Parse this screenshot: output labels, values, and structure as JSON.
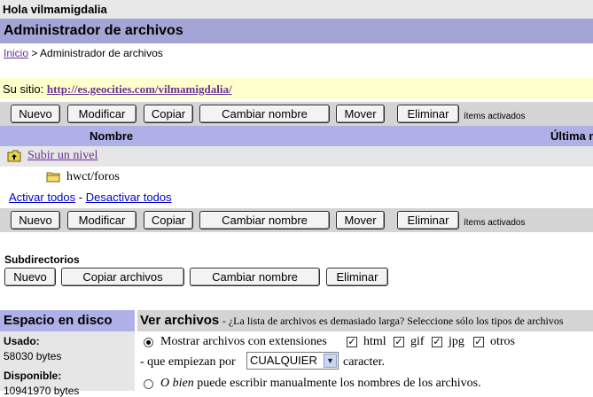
{
  "greeting": "Hola vilmamigdalia",
  "page_title": "Administrador de archivos",
  "breadcrumb": {
    "home": "Inicio",
    "separator": ">",
    "current": "Administrador de archivos"
  },
  "site": {
    "label": "Su sitio:",
    "url": "http://es.geocities.com/vilmamigdalia/"
  },
  "toolbar": {
    "new": "Nuevo",
    "modify": "Modificar",
    "copy": "Copiar",
    "rename": "Cambiar nombre",
    "move": "Mover",
    "delete": "Eliminar",
    "items_active": "ítems activados"
  },
  "table": {
    "col_name": "Nombre",
    "col_modified": "Última m",
    "up_level": "Subir un nivel",
    "rows": [
      {
        "name": "hwct/foros",
        "icon": "folder-icon"
      }
    ]
  },
  "selection": {
    "activate_all": "Activar todos",
    "separator": "-",
    "deactivate_all": "Desactivar todos"
  },
  "subdirs": {
    "label": "Subdirectorios",
    "new": "Nuevo",
    "copy_files": "Copiar archivos",
    "rename": "Cambiar nombre",
    "delete": "Eliminar"
  },
  "disk": {
    "title": "Espacio en disco",
    "used_label": "Usado:",
    "used_value": "58030 bytes",
    "available_label": "Disponible:",
    "available_value": "10941970 bytes"
  },
  "view": {
    "title": "Ver archivos",
    "subtitle": "- ¿La lista de archivos es demasiado larga? Seleccione sólo los tipos de archivos",
    "show_ext_label": "Mostrar archivos con extensiones",
    "ext_html": "html",
    "ext_gif": "gif",
    "ext_jpg": "jpg",
    "ext_other": "otros",
    "starting_prefix": "- que empiezan por",
    "starting_value": "CUALQUIER",
    "starting_suffix": "caracter.",
    "manual_italic": "O bien",
    "manual_rest": "puede escribir manualmente los nombres de los archivos."
  },
  "colors": {
    "title_bar": "#a4a4d6",
    "header_blue": "#b0b0e8",
    "toolbar_gray": "#d4d4d4",
    "site_bar": "#ffffcc",
    "link": "#663399"
  }
}
